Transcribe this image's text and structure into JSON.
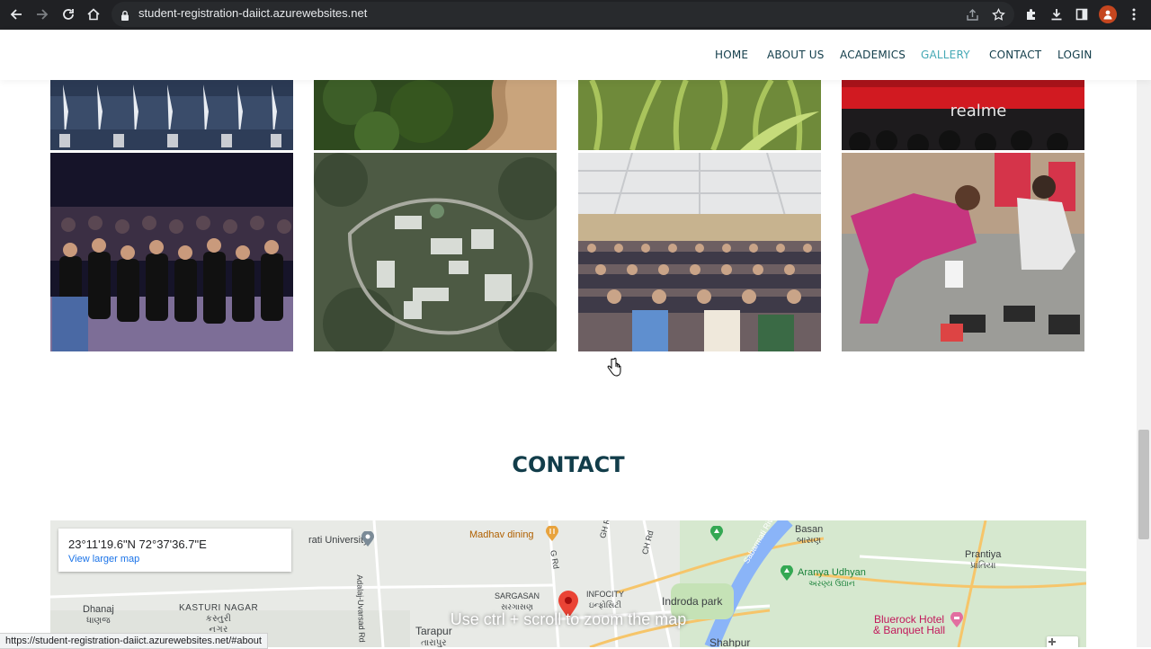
{
  "browser": {
    "url": "student-registration-daiict.azurewebsites.net",
    "status_url": "https://student-registration-daiict.azurewebsites.net/#about"
  },
  "nav": {
    "items": [
      {
        "label": "HOME"
      },
      {
        "label": "ABOUT US"
      },
      {
        "label": "ACADEMICS"
      },
      {
        "label": "GALLERY",
        "active": true
      },
      {
        "label": "CONTACT"
      },
      {
        "label": "LOGIN"
      }
    ],
    "active_color": "#45a9b5",
    "text_color": "#123d4a"
  },
  "gallery": {
    "photos_top": [
      "graduates-photo",
      "forest-path-photo",
      "grass-photo",
      "stage-event-photo"
    ],
    "photos_bottom": [
      "crowd-group-photo",
      "campus-aerial-photo",
      "auditorium-photo",
      "robotics-workshop-photo"
    ],
    "stage_banner": "realme"
  },
  "contact": {
    "title": "CONTACT"
  },
  "map": {
    "coords": "23°11'19.6\"N 72°37'36.7\"E",
    "view_larger": "View larger map",
    "hint": "Use ctrl + scroll to zoom the map",
    "labels": {
      "university": "rati University",
      "madhav": "Madhav dining",
      "basan": "Basan",
      "basan_gu": "બાસણ",
      "prantiya": "Prantiya",
      "prantiya_gu": "પ્રાંતિયા",
      "aranya": "Aranya Udhyan",
      "aranya_gu": "અરણ્ય ઉદ્યાન",
      "dhanaj": "Dhanaj",
      "dhanaj_gu": "ધાણજ",
      "kasturi": "KASTURI NAGAR",
      "kasturi_gu": "કસ્તુરી",
      "kasturi_gu2": "નગર",
      "sargasan": "SARGASAN",
      "sargasan_gu": "સરગાસણ",
      "infocity": "INFOCITY",
      "infocity_gu": "ઇન્ફોસિટી",
      "indroda": "Indroda park",
      "bluerock": "Bluerock Hotel",
      "bluerock2": "& Banquet Hall",
      "tarapur": "Tarapur",
      "tarapur_gu": "તારાપુર",
      "shahpur": "Shahpur",
      "adalaj_rd": "Adalaj-Uvarsad Rd",
      "g_rd": "G Rd",
      "gh_rd": "GH Rd",
      "ch_rd": "CH Rd",
      "river": "Sabarmati River"
    }
  }
}
